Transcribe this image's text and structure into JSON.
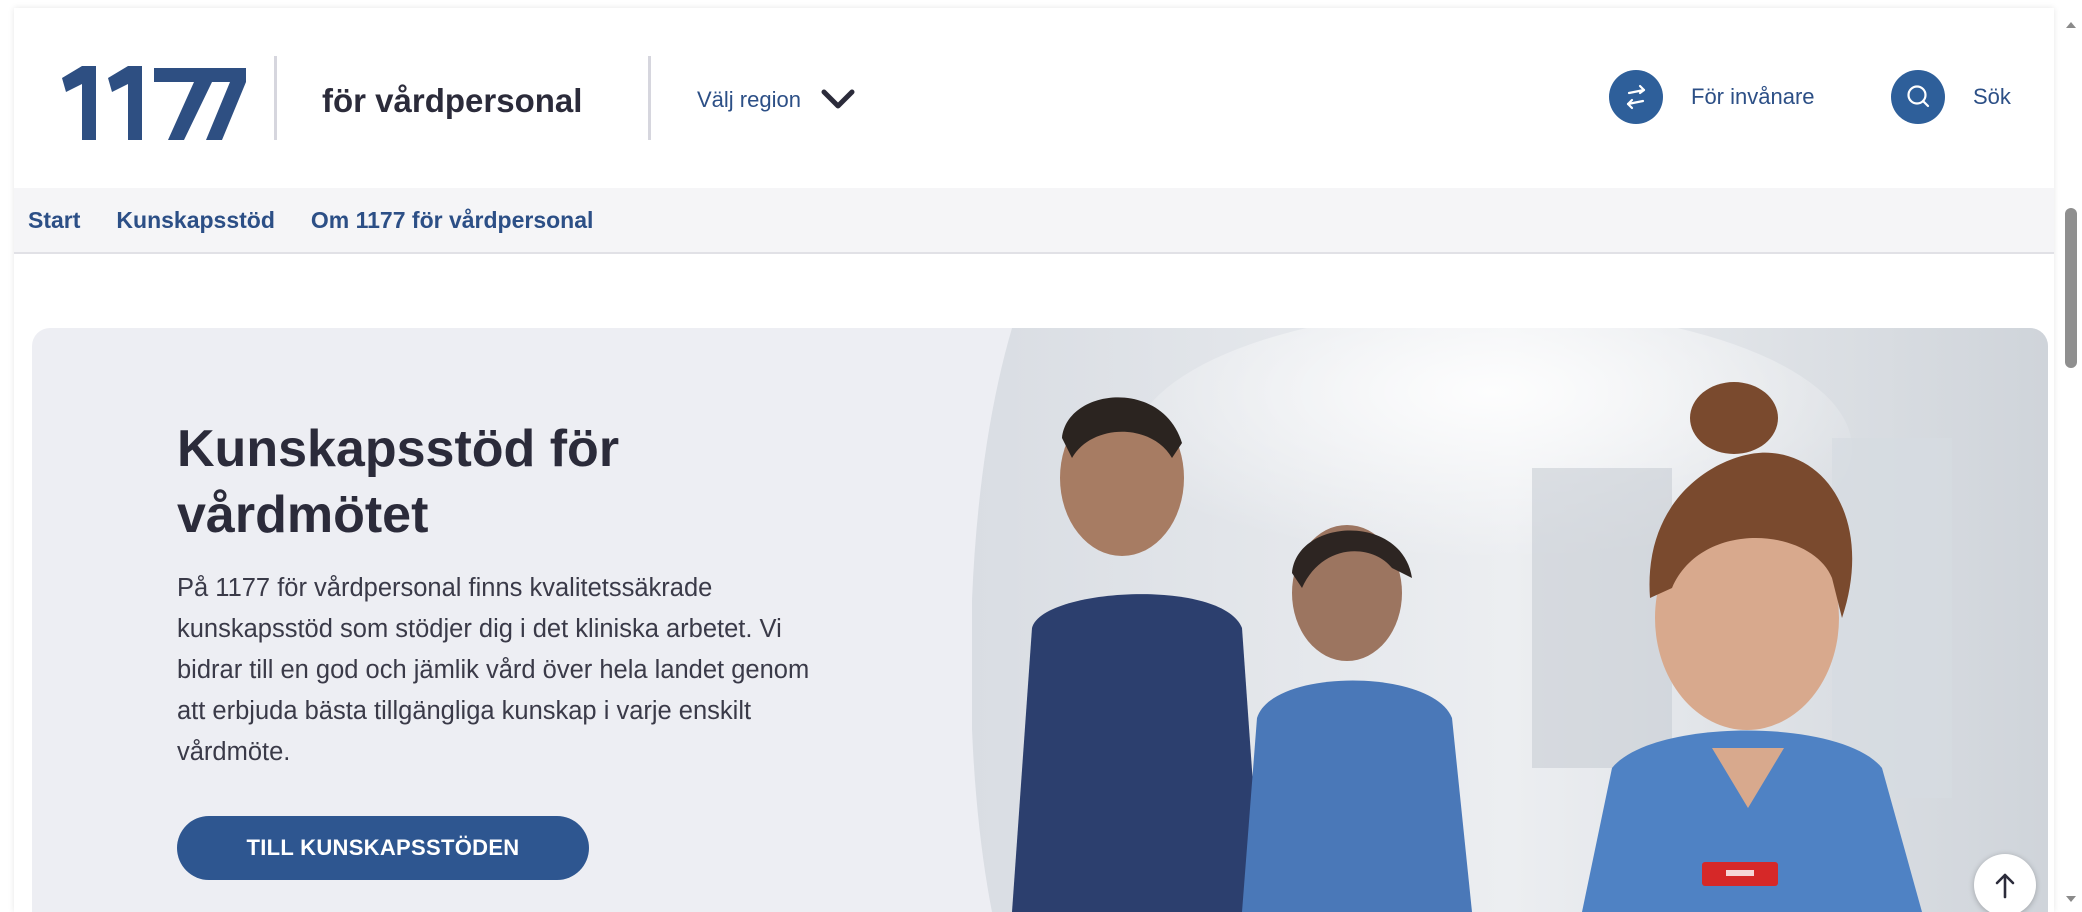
{
  "header": {
    "logo_text": "1177",
    "site_title": "för vårdpersonal",
    "region_label": "Välj region",
    "region_icon": "chevron-down-icon",
    "invanare_label": "För invånare",
    "invanare_icon": "swap-arrows-icon",
    "search_label": "Sök",
    "search_icon": "search-icon"
  },
  "nav": {
    "items": [
      {
        "label": "Start"
      },
      {
        "label": "Kunskapsstöd"
      },
      {
        "label": "Om 1177 för vårdpersonal"
      }
    ]
  },
  "hero": {
    "title": "Kunskapsstöd för vårdmötet",
    "text": "På 1177 för vårdpersonal finns kvalitetssäkrade kunskapsstöd som stödjer dig i det kliniska arbetet. Vi bidrar till en god och jämlik vård över hela landet genom att erbjuda bästa tillgängliga kunskap i varje enskilt vårdmöte.",
    "button_label": "TILL KUNSKAPSSTÖDEN",
    "image": "healthcare-staff-photo",
    "back_to_top_icon": "arrow-up-icon"
  },
  "colors": {
    "brand_blue": "#2e5f9a",
    "link_blue": "#2c4f86",
    "button_blue": "#2e5690",
    "hero_bg": "#edeef3",
    "scrub_blue": "#3f6fb5"
  }
}
